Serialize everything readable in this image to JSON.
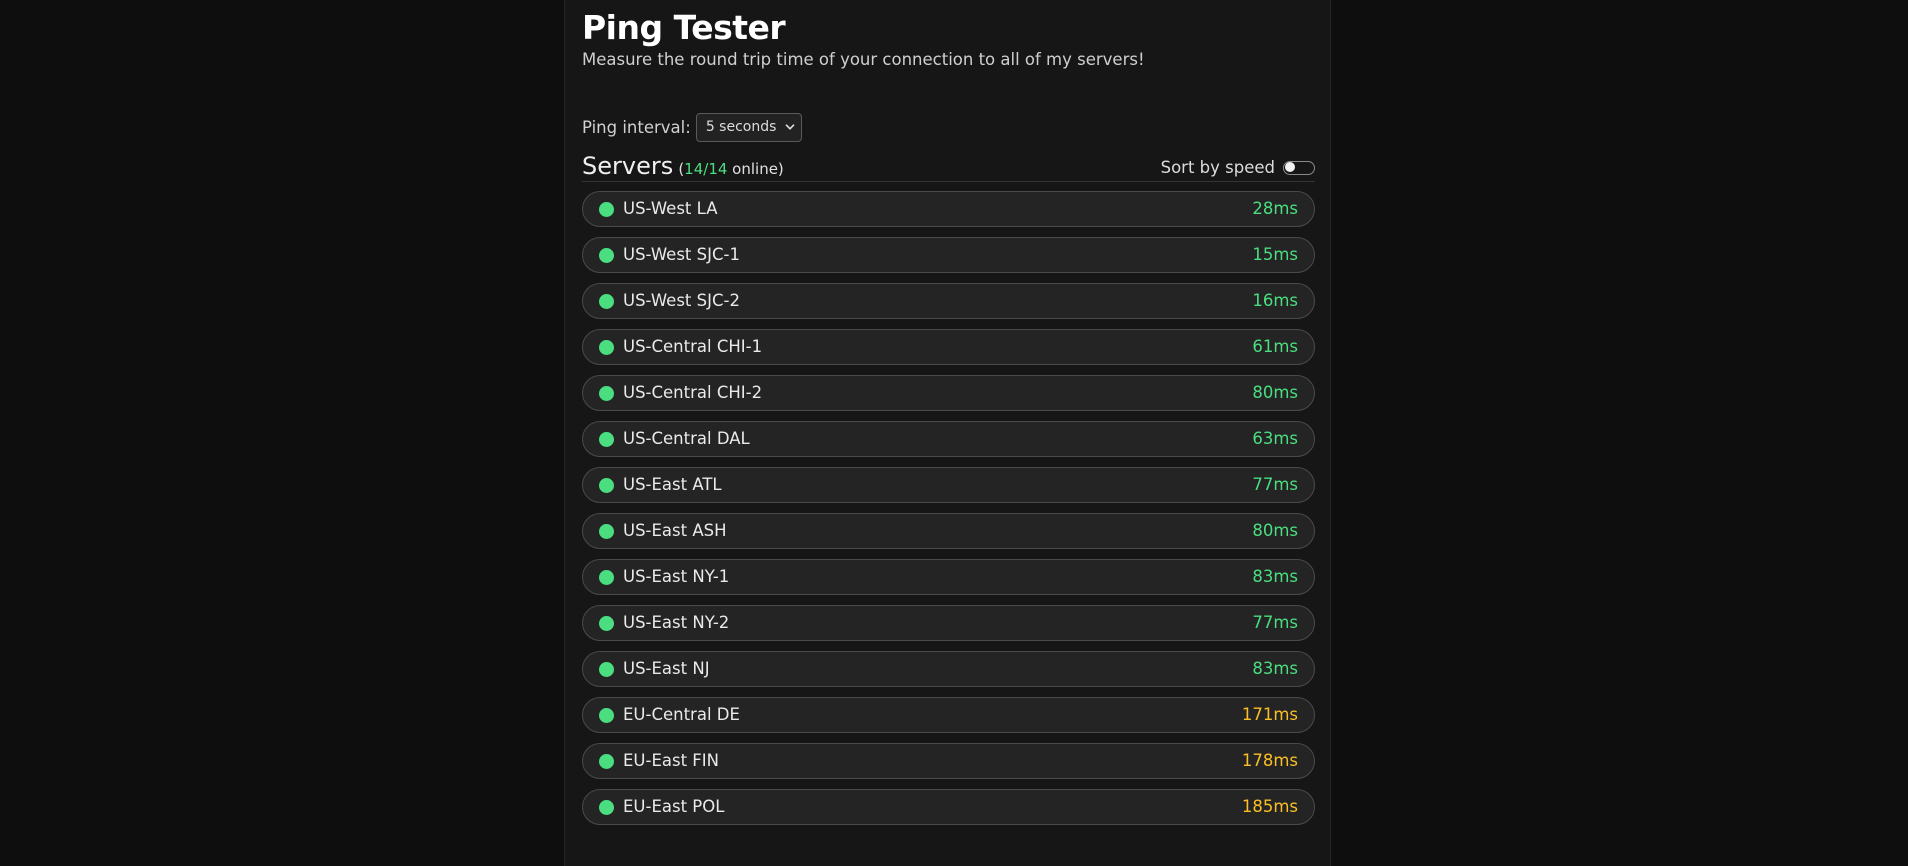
{
  "header": {
    "title": "Ping Tester",
    "subtitle": "Measure the round trip time of your connection to all of my servers!"
  },
  "controls": {
    "interval_label": "Ping interval:",
    "interval_selected": "5 seconds",
    "sort_label": "Sort by speed",
    "sort_enabled": false
  },
  "servers": {
    "heading": "Servers",
    "count_open": "(",
    "online_count": "14/14",
    "count_suffix": " online)",
    "colors": {
      "online_dot": "#4ade80",
      "ping_good": "#4ade80",
      "ping_warn": "#fbbf24"
    },
    "items": [
      {
        "name": "US-West LA",
        "ping": "28ms",
        "status": "online",
        "level": "good"
      },
      {
        "name": "US-West SJC-1",
        "ping": "15ms",
        "status": "online",
        "level": "good"
      },
      {
        "name": "US-West SJC-2",
        "ping": "16ms",
        "status": "online",
        "level": "good"
      },
      {
        "name": "US-Central CHI-1",
        "ping": "61ms",
        "status": "online",
        "level": "good"
      },
      {
        "name": "US-Central CHI-2",
        "ping": "80ms",
        "status": "online",
        "level": "good"
      },
      {
        "name": "US-Central DAL",
        "ping": "63ms",
        "status": "online",
        "level": "good"
      },
      {
        "name": "US-East ATL",
        "ping": "77ms",
        "status": "online",
        "level": "good"
      },
      {
        "name": "US-East ASH",
        "ping": "80ms",
        "status": "online",
        "level": "good"
      },
      {
        "name": "US-East NY-1",
        "ping": "83ms",
        "status": "online",
        "level": "good"
      },
      {
        "name": "US-East NY-2",
        "ping": "77ms",
        "status": "online",
        "level": "good"
      },
      {
        "name": "US-East NJ",
        "ping": "83ms",
        "status": "online",
        "level": "good"
      },
      {
        "name": "EU-Central DE",
        "ping": "171ms",
        "status": "online",
        "level": "warn"
      },
      {
        "name": "EU-East FIN",
        "ping": "178ms",
        "status": "online",
        "level": "warn"
      },
      {
        "name": "EU-East POL",
        "ping": "185ms",
        "status": "online",
        "level": "warn"
      }
    ]
  }
}
